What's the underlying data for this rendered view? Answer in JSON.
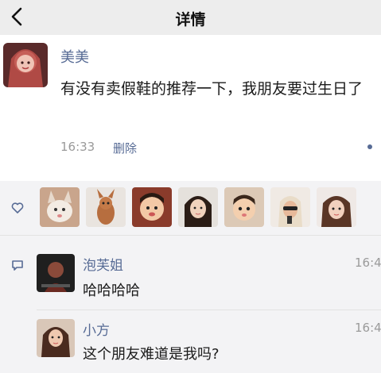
{
  "header": {
    "title": "详情"
  },
  "post": {
    "author": "美美",
    "text": "有没有卖假鞋的推荐一下，我朋友要过生日了",
    "time": "16:33",
    "delete_label": "删除"
  },
  "likes": {
    "count_avatars": 7
  },
  "comments": [
    {
      "name": "泡芙姐",
      "text": "哈哈哈哈",
      "time": "16:4"
    },
    {
      "name": "小方",
      "text": "这个朋友难道是我吗?",
      "time": "16:4"
    }
  ],
  "colors": {
    "link": "#576b95",
    "header_bg": "#ededed",
    "panel_bg": "#f3f3f5"
  },
  "icons": {
    "back": "chevron-left-icon",
    "like": "heart-outline-icon",
    "comment": "comment-bubble-icon"
  }
}
